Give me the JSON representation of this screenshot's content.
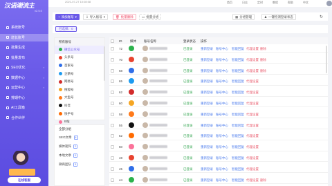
{
  "app": {
    "logo": "汉语潮流主",
    "version": "v2.5.0",
    "date": "2021-07-27 10:08:08"
  },
  "topnav": [
    "首页",
    "日志",
    "定时",
    "教程",
    "帮助",
    "中文"
  ],
  "sidebar": [
    {
      "label": "系统账号"
    },
    {
      "label": "增长账号",
      "active": true
    },
    {
      "label": "批量生成"
    },
    {
      "label": "批量发布"
    },
    {
      "label": "SEO优化",
      "arrow": "›"
    },
    {
      "label": "数据中心",
      "arrow": "›"
    },
    {
      "label": "运营中心",
      "arrow": "›"
    },
    {
      "label": "排期中心"
    },
    {
      "label": "AI工具箱"
    },
    {
      "label": "合作伙伴"
    }
  ],
  "promo": {
    "button": "在线客服"
  },
  "toolbar": {
    "add": "添加账号",
    "import": "导入账号",
    "batch_delete": "批量删除",
    "batch_group": "批量分组",
    "group_manage": "分组管理",
    "one_click": "一键检测登录状态"
  },
  "filter": {
    "selected": "已选择：0"
  },
  "platform_panel": {
    "title": "所有账号",
    "items": [
      {
        "label": "微信公众号",
        "color": "#2bb24c",
        "active": true
      },
      {
        "label": "头条号",
        "color": "#e8432f"
      },
      {
        "label": "百家号",
        "color": "#2f6ee8"
      },
      {
        "label": "企鹅号",
        "color": "#1d9bf0"
      },
      {
        "label": "网易号",
        "color": "#d22b2b"
      },
      {
        "label": "搜狐号",
        "color": "#f5a623"
      },
      {
        "label": "大鱼号",
        "color": "#ff7a1a"
      },
      {
        "label": "抖音",
        "color": "#111111"
      },
      {
        "label": "快手号",
        "color": "#ff6a00"
      },
      {
        "label": "B站",
        "color": "#fb7299"
      }
    ]
  },
  "groups": {
    "title": "全部分组",
    "items": [
      {
        "label": "SEO文章",
        "count": "4"
      },
      {
        "label": "媒体矩阵",
        "count": "2"
      },
      {
        "label": "本地文章",
        "count": "0"
      },
      {
        "label": "微商团队",
        "count": "3"
      }
    ]
  },
  "table": {
    "headers": [
      "ID",
      "媒体",
      "账号名称",
      "登录状态",
      "操作"
    ],
    "rows": [
      {
        "id": "72",
        "color": "#2bb24c",
        "status": "已登录"
      },
      {
        "id": "70",
        "color": "#e8432f",
        "status": "已登录"
      },
      {
        "id": "68",
        "color": "#2f6ee8",
        "status": "已登录"
      },
      {
        "id": "65",
        "color": "#1d9bf0",
        "status": "已登录"
      },
      {
        "id": "62",
        "color": "#d22b2b",
        "status": "已登录"
      },
      {
        "id": "60",
        "color": "#f5a623",
        "status": "已登录"
      },
      {
        "id": "58",
        "color": "#ff7a1a",
        "status": "已登录"
      },
      {
        "id": "55",
        "color": "#111111",
        "status": "已登录"
      },
      {
        "id": "52",
        "color": "#ff6a00",
        "status": "已登录"
      },
      {
        "id": "50",
        "color": "#fb7299",
        "status": "已登录"
      },
      {
        "id": "48",
        "color": "#e8432f",
        "status": "已登录"
      },
      {
        "id": "45",
        "color": "#2f6ee8",
        "status": "已登录"
      },
      {
        "id": "44",
        "color": "#2bb24c",
        "status": "已登录"
      }
    ],
    "actions": [
      "重新登录",
      "账号中心",
      "智能回复",
      "代理设置",
      "删除"
    ]
  }
}
